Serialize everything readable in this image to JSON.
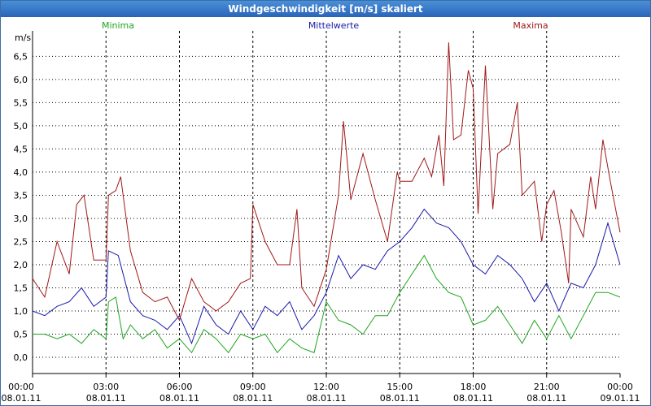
{
  "window": {
    "title": "Windgeschwindigkeit [m/s] skaliert"
  },
  "colors": {
    "minima": "#1fa51f",
    "mittel": "#1a1aaa",
    "maxima": "#a01818",
    "grid": "#000000"
  },
  "chart_data": {
    "type": "line",
    "title": "Windgeschwindigkeit [m/s] skaliert",
    "ylabel": "m/s",
    "xlabel": "",
    "ylim": [
      -0.35,
      7.05
    ],
    "xlim": [
      0,
      24
    ],
    "y_ticks": [
      "0,0",
      "0,5",
      "1,0",
      "1,5",
      "2,0",
      "2,5",
      "3,0",
      "3,5",
      "4,0",
      "4,5",
      "5,0",
      "5,5",
      "6,0",
      "6,5"
    ],
    "x_ticks": [
      {
        "time": "00:00",
        "date": "08.01.11"
      },
      {
        "time": "03:00",
        "date": "08.01.11"
      },
      {
        "time": "06:00",
        "date": "08.01.11"
      },
      {
        "time": "09:00",
        "date": "08.01.11"
      },
      {
        "time": "12:00",
        "date": "08.01.11"
      },
      {
        "time": "15:00",
        "date": "08.01.11"
      },
      {
        "time": "18:00",
        "date": "08.01.11"
      },
      {
        "time": "21:00",
        "date": "08.01.11"
      },
      {
        "time": "00:00",
        "date": "09.01.11"
      }
    ],
    "legend_placement": "top",
    "grid": true,
    "series": [
      {
        "name": "Minima",
        "key": "minima",
        "points": [
          [
            0,
            0.5
          ],
          [
            0.5,
            0.5
          ],
          [
            1,
            0.4
          ],
          [
            1.5,
            0.5
          ],
          [
            2,
            0.3
          ],
          [
            2.5,
            0.6
          ],
          [
            3,
            0.4
          ],
          [
            3.1,
            1.2
          ],
          [
            3.4,
            1.3
          ],
          [
            3.7,
            0.4
          ],
          [
            4,
            0.7
          ],
          [
            4.5,
            0.4
          ],
          [
            5,
            0.6
          ],
          [
            5.5,
            0.2
          ],
          [
            6,
            0.4
          ],
          [
            6.5,
            0.1
          ],
          [
            7,
            0.6
          ],
          [
            7.5,
            0.4
          ],
          [
            8,
            0.1
          ],
          [
            8.5,
            0.5
          ],
          [
            9,
            0.4
          ],
          [
            9.5,
            0.5
          ],
          [
            10,
            0.1
          ],
          [
            10.5,
            0.4
          ],
          [
            11,
            0.2
          ],
          [
            11.5,
            0.1
          ],
          [
            12,
            1.2
          ],
          [
            12.5,
            0.8
          ],
          [
            13,
            0.7
          ],
          [
            13.5,
            0.5
          ],
          [
            14,
            0.9
          ],
          [
            14.5,
            0.9
          ],
          [
            15,
            1.4
          ],
          [
            15.5,
            1.8
          ],
          [
            16,
            2.2
          ],
          [
            16.5,
            1.7
          ],
          [
            17,
            1.4
          ],
          [
            17.5,
            1.3
          ],
          [
            18,
            0.7
          ],
          [
            18.5,
            0.8
          ],
          [
            19,
            1.1
          ],
          [
            19.5,
            0.7
          ],
          [
            20,
            0.3
          ],
          [
            20.5,
            0.8
          ],
          [
            21,
            0.4
          ],
          [
            21.5,
            0.9
          ],
          [
            22,
            0.4
          ],
          [
            22.5,
            0.9
          ],
          [
            23,
            1.4
          ],
          [
            23.5,
            1.4
          ],
          [
            24,
            1.3
          ]
        ]
      },
      {
        "name": "Mittelwerte",
        "key": "mittel",
        "points": [
          [
            0,
            1.0
          ],
          [
            0.5,
            0.9
          ],
          [
            1,
            1.1
          ],
          [
            1.5,
            1.2
          ],
          [
            2,
            1.5
          ],
          [
            2.5,
            1.1
          ],
          [
            3,
            1.3
          ],
          [
            3.1,
            2.3
          ],
          [
            3.5,
            2.2
          ],
          [
            4,
            1.2
          ],
          [
            4.5,
            0.9
          ],
          [
            5,
            0.8
          ],
          [
            5.5,
            0.6
          ],
          [
            6,
            0.9
          ],
          [
            6.5,
            0.3
          ],
          [
            7,
            1.1
          ],
          [
            7.5,
            0.7
          ],
          [
            8,
            0.5
          ],
          [
            8.5,
            1.0
          ],
          [
            9,
            0.6
          ],
          [
            9.5,
            1.1
          ],
          [
            10,
            0.9
          ],
          [
            10.5,
            1.2
          ],
          [
            11,
            0.6
          ],
          [
            11.5,
            0.9
          ],
          [
            12,
            1.4
          ],
          [
            12.5,
            2.2
          ],
          [
            13,
            1.7
          ],
          [
            13.5,
            2.0
          ],
          [
            14,
            1.9
          ],
          [
            14.5,
            2.3
          ],
          [
            15,
            2.5
          ],
          [
            15.5,
            2.8
          ],
          [
            16,
            3.2
          ],
          [
            16.5,
            2.9
          ],
          [
            17,
            2.8
          ],
          [
            17.5,
            2.5
          ],
          [
            18,
            2.0
          ],
          [
            18.5,
            1.8
          ],
          [
            19,
            2.2
          ],
          [
            19.5,
            2.0
          ],
          [
            20,
            1.7
          ],
          [
            20.5,
            1.2
          ],
          [
            21,
            1.6
          ],
          [
            21.5,
            1.0
          ],
          [
            22,
            1.6
          ],
          [
            22.5,
            1.5
          ],
          [
            23,
            2.0
          ],
          [
            23.5,
            2.9
          ],
          [
            24,
            2.0
          ]
        ]
      },
      {
        "name": "Maxima",
        "key": "maxima",
        "points": [
          [
            0,
            1.7
          ],
          [
            0.5,
            1.3
          ],
          [
            1,
            2.5
          ],
          [
            1.5,
            1.8
          ],
          [
            1.8,
            3.3
          ],
          [
            2.1,
            3.5
          ],
          [
            2.5,
            2.1
          ],
          [
            3,
            2.1
          ],
          [
            3.1,
            3.5
          ],
          [
            3.4,
            3.6
          ],
          [
            3.6,
            3.9
          ],
          [
            4,
            2.3
          ],
          [
            4.5,
            1.4
          ],
          [
            5,
            1.2
          ],
          [
            5.5,
            1.3
          ],
          [
            6,
            0.8
          ],
          [
            6.5,
            1.7
          ],
          [
            7,
            1.2
          ],
          [
            7.5,
            1.0
          ],
          [
            8,
            1.2
          ],
          [
            8.5,
            1.6
          ],
          [
            8.9,
            1.7
          ],
          [
            9,
            3.3
          ],
          [
            9.5,
            2.5
          ],
          [
            10,
            2.0
          ],
          [
            10.5,
            2.0
          ],
          [
            10.8,
            3.2
          ],
          [
            11,
            1.5
          ],
          [
            11.5,
            1.1
          ],
          [
            12,
            1.9
          ],
          [
            12.5,
            3.5
          ],
          [
            12.7,
            5.1
          ],
          [
            13,
            3.4
          ],
          [
            13.5,
            4.4
          ],
          [
            14,
            3.4
          ],
          [
            14.5,
            2.5
          ],
          [
            14.9,
            4.0
          ],
          [
            15,
            3.8
          ],
          [
            15.5,
            3.8
          ],
          [
            16,
            4.3
          ],
          [
            16.3,
            3.9
          ],
          [
            16.6,
            4.8
          ],
          [
            16.8,
            3.7
          ],
          [
            17,
            6.8
          ],
          [
            17.2,
            4.7
          ],
          [
            17.5,
            4.8
          ],
          [
            17.8,
            6.2
          ],
          [
            18,
            5.8
          ],
          [
            18.2,
            3.1
          ],
          [
            18.5,
            6.3
          ],
          [
            18.8,
            3.2
          ],
          [
            19,
            4.4
          ],
          [
            19.5,
            4.6
          ],
          [
            19.8,
            5.5
          ],
          [
            20,
            3.5
          ],
          [
            20.5,
            3.8
          ],
          [
            20.8,
            2.5
          ],
          [
            21,
            3.3
          ],
          [
            21.3,
            3.6
          ],
          [
            21.6,
            2.7
          ],
          [
            21.9,
            1.6
          ],
          [
            22,
            3.2
          ],
          [
            22.5,
            2.6
          ],
          [
            22.8,
            3.9
          ],
          [
            23,
            3.2
          ],
          [
            23.3,
            4.7
          ],
          [
            23.6,
            3.8
          ],
          [
            24,
            2.7
          ]
        ]
      }
    ]
  }
}
